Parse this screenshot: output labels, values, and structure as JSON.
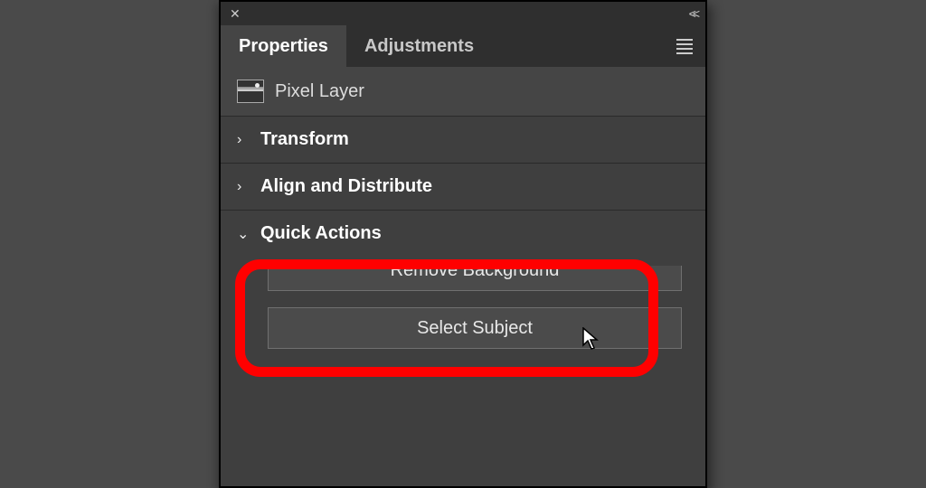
{
  "tabs": {
    "properties": "Properties",
    "adjustments": "Adjustments"
  },
  "layer": {
    "title": "Pixel Layer"
  },
  "sections": {
    "transform": "Transform",
    "align": "Align and Distribute",
    "quick": "Quick Actions"
  },
  "actions": {
    "remove_bg": "Remove Background",
    "select_subject": "Select Subject"
  }
}
